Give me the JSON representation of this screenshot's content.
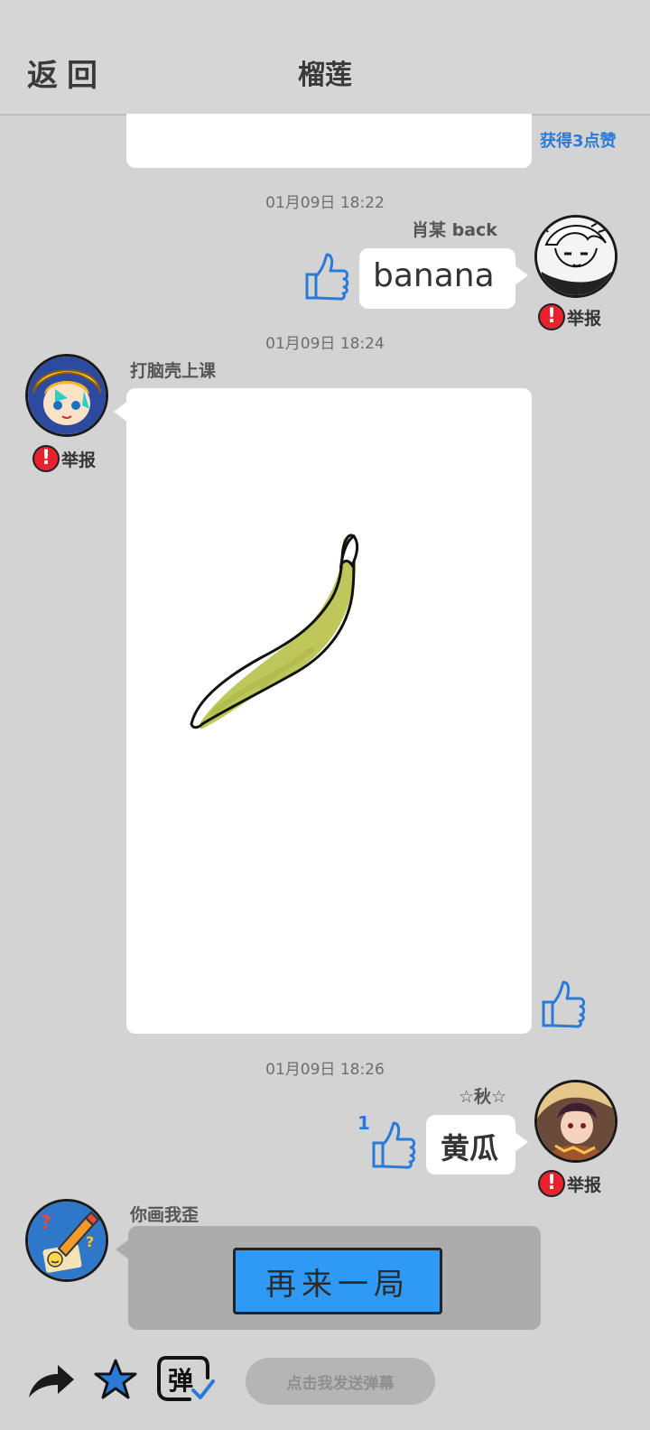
{
  "header": {
    "back_label": "返回",
    "title": "榴莲"
  },
  "top_partial": {
    "praise_text": "获得3点赞"
  },
  "messages": [
    {
      "time": "01月09日  18:22",
      "sender": "肖某   back",
      "text": "banana",
      "report_label": "举报"
    },
    {
      "time": "01月09日  18:24",
      "sender": "打脑壳上课",
      "report_label": "举报"
    },
    {
      "time": "01月09日  18:26",
      "sender": "☆秋☆",
      "text": "黄瓜",
      "like_count": "1",
      "report_label": "举报"
    },
    {
      "sender": "你画我歪",
      "button_label": "再来一局"
    }
  ],
  "bottom": {
    "danmu_placeholder": "点击我发送弹幕",
    "danmu_icon_char": "弹"
  },
  "colors": {
    "accent_blue": "#2a7bd9",
    "report_red": "#e5222e",
    "banana_green": "#bdc75a",
    "background": "#d3d3d3"
  },
  "icons": [
    "thumbs-up-icon",
    "share-arrow-icon",
    "star-icon",
    "danmu-icon",
    "exclamation-icon"
  ]
}
